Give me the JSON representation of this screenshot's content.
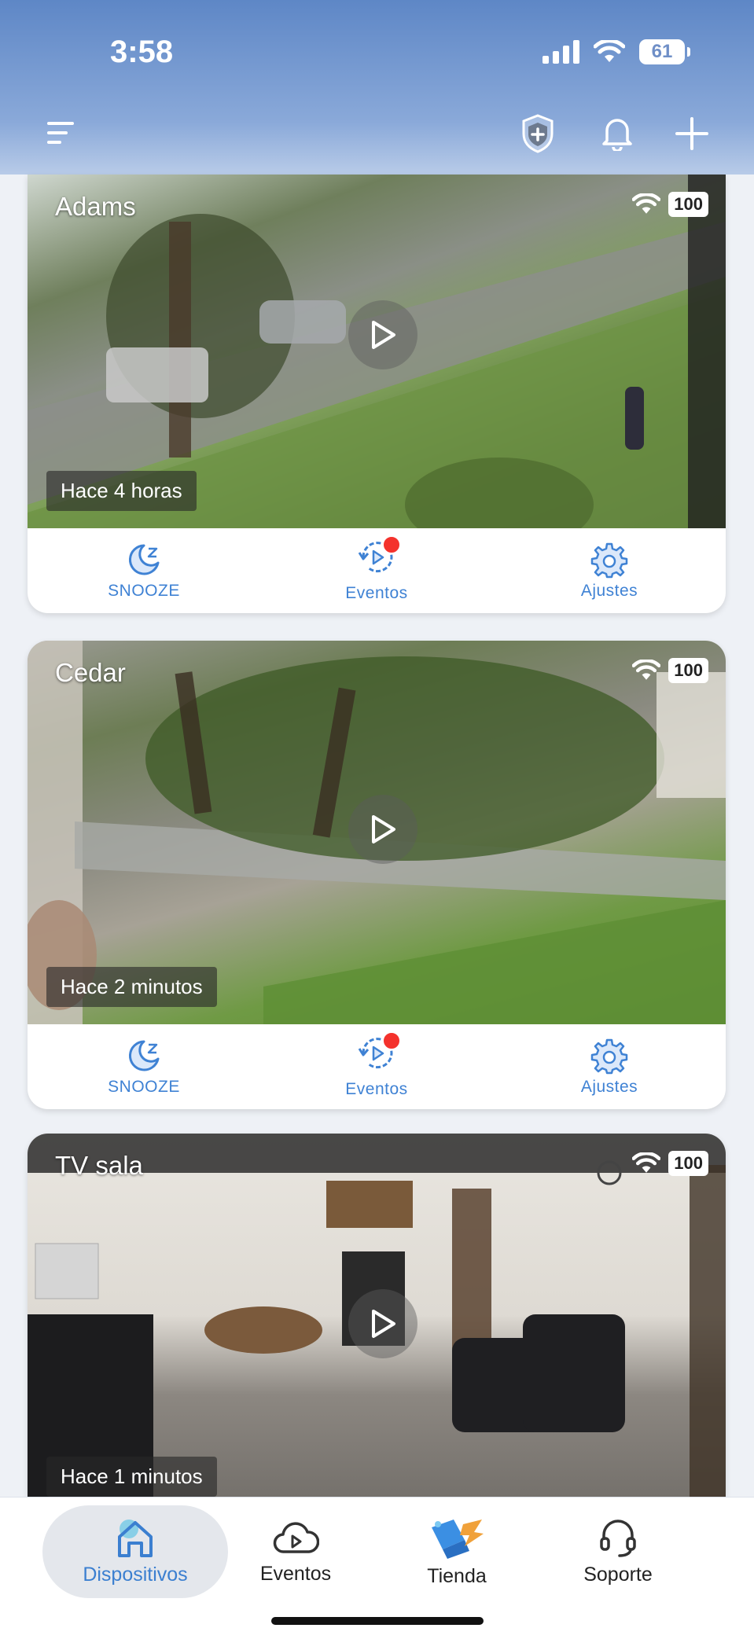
{
  "status_bar": {
    "time": "3:58",
    "battery": "61"
  },
  "header": {
    "menu_icon": "menu-icon",
    "shield_icon": "shield-plus-icon",
    "bell_icon": "bell-icon",
    "add_icon": "plus-icon"
  },
  "cameras": [
    {
      "name": "Adams",
      "battery": "100",
      "timestamp": "Hace 4 horas",
      "actions": {
        "snooze": "SNOOZE",
        "events": "Eventos",
        "settings": "Ajustes"
      },
      "has_new_events": true
    },
    {
      "name": "Cedar",
      "battery": "100",
      "timestamp": "Hace 2 minutos",
      "actions": {
        "snooze": "SNOOZE",
        "events": "Eventos",
        "settings": "Ajustes"
      },
      "has_new_events": true
    },
    {
      "name": "TV sala",
      "battery": "100",
      "timestamp": "Hace 1 minutos"
    }
  ],
  "tabbar": {
    "tabs": [
      {
        "label": "Dispositivos",
        "icon": "home-icon",
        "active": true
      },
      {
        "label": "Eventos",
        "icon": "cloud-play-icon",
        "active": false
      },
      {
        "label": "Tienda",
        "icon": "store-icon",
        "active": false
      },
      {
        "label": "Soporte",
        "icon": "headset-icon",
        "active": false
      }
    ]
  },
  "colors": {
    "accent": "#3f82d4",
    "header_top": "#5e87c6",
    "badge_red": "#f4322c"
  }
}
